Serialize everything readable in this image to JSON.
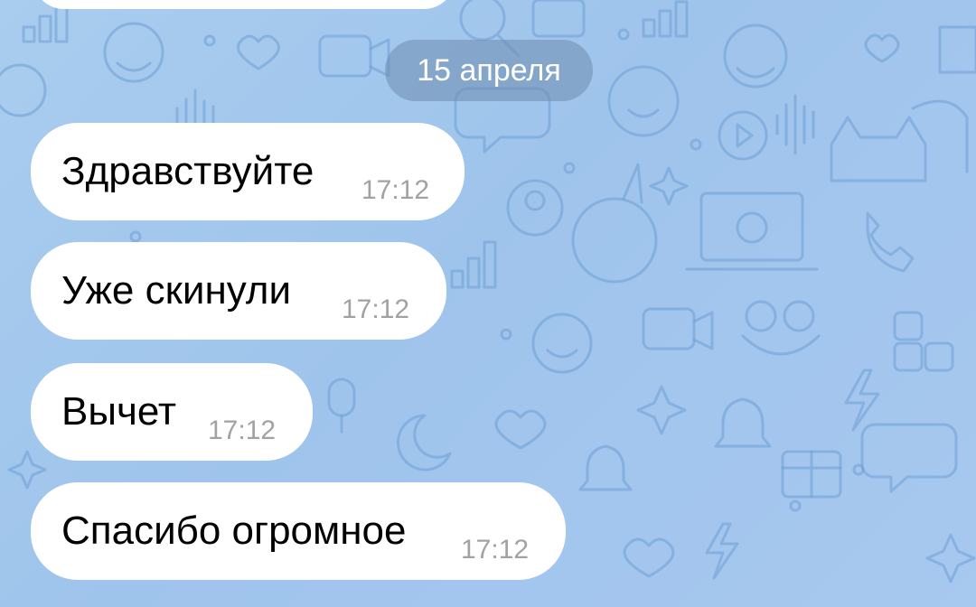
{
  "date_separator": "15 апреля",
  "messages": [
    {
      "text": "Здравствуйте",
      "time": "17:12"
    },
    {
      "text": "Уже скинули",
      "time": "17:12"
    },
    {
      "text": "Вычет",
      "time": "17:12"
    },
    {
      "text": "Спасибо огромное",
      "time": "17:12"
    }
  ],
  "colors": {
    "bubble": "#ffffff",
    "wallpaper": "#a9cdee",
    "doodle_stroke": "#6d9fd6",
    "time_text": "#a2a2a2",
    "date_pill": "#7c96b6"
  }
}
